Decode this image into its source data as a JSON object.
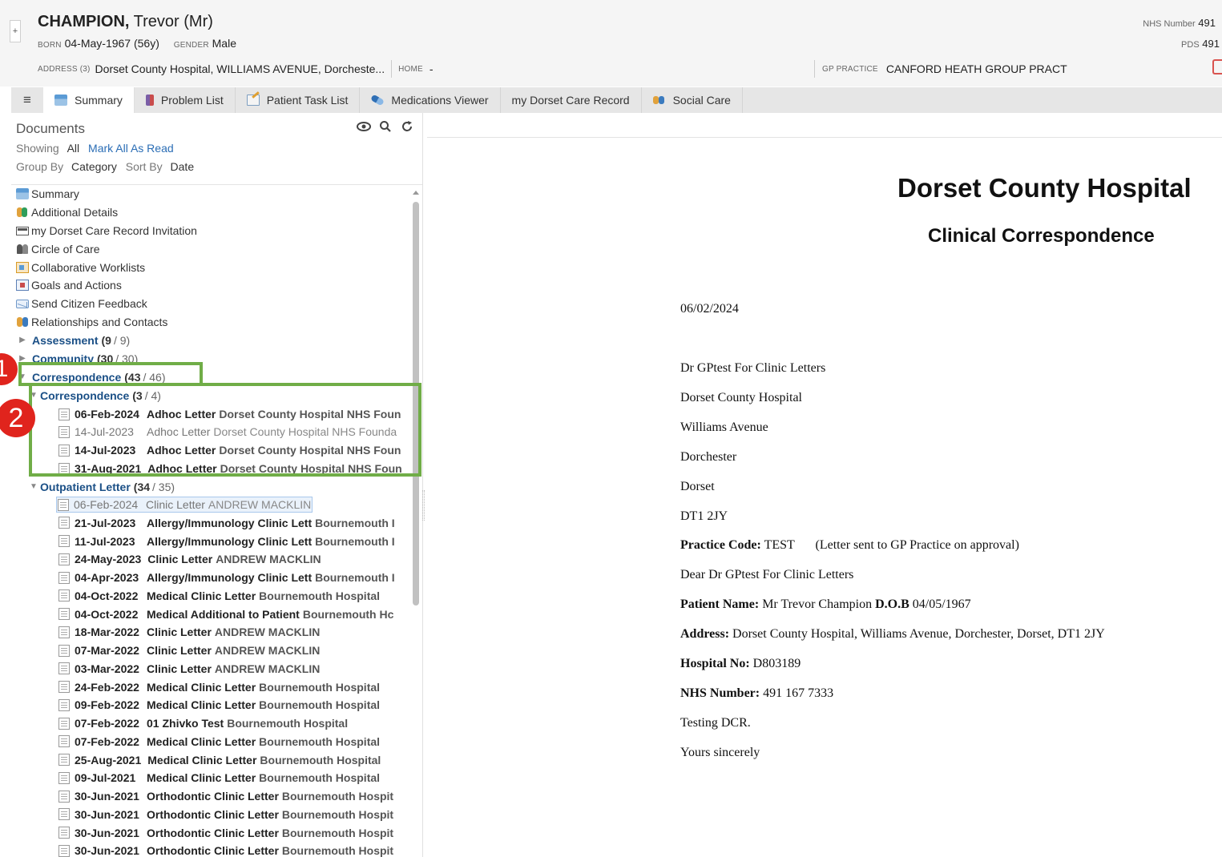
{
  "patient": {
    "surname": "CHAMPION,",
    "forename_title": "Trevor (Mr)",
    "born_label": "BORN",
    "born_value": "04-May-1967 (56y)",
    "gender_label": "GENDER",
    "gender_value": "Male",
    "address_label": "ADDRESS (3)",
    "address_value": "Dorset County Hospital, WILLIAMS AVENUE, Dorcheste...",
    "home_label": "HOME",
    "home_value": "-",
    "gp_label": "GP PRACTICE",
    "gp_value": "CANFORD HEATH GROUP PRACT",
    "nhs_label": "NHS Number",
    "nhs_value": "491",
    "pds_label": "PDS",
    "pds_value": "491",
    "expand_glyph": "+"
  },
  "tabs": [
    {
      "label": "Summary",
      "icon": "summary-icon",
      "active": true
    },
    {
      "label": "Problem List",
      "icon": "problem-list-icon"
    },
    {
      "label": "Patient Task List",
      "icon": "task-list-icon"
    },
    {
      "label": "Medications Viewer",
      "icon": "pill-icon"
    },
    {
      "label": "my Dorset Care Record",
      "icon": ""
    },
    {
      "label": "Social Care",
      "icon": "social-care-icon"
    }
  ],
  "menu_glyph": "≡",
  "documents": {
    "title": "Documents",
    "showing_label": "Showing",
    "showing_value": "All",
    "mark_all_read": "Mark All As Read",
    "group_by_label": "Group By",
    "group_by_value": "Category",
    "sort_by_label": "Sort By",
    "sort_by_value": "Date",
    "nav_items": [
      {
        "label": "Summary",
        "icon": "summary-icon"
      },
      {
        "label": "Additional Details",
        "icon": "people-icon"
      },
      {
        "label": "my Dorset Care Record Invitation",
        "icon": "invitation-icon"
      },
      {
        "label": "Circle of Care",
        "icon": "circle-of-care-icon"
      },
      {
        "label": "Collaborative Worklists",
        "icon": "worklist-icon"
      },
      {
        "label": "Goals and Actions",
        "icon": "goals-icon"
      },
      {
        "label": "Send Citizen Feedback",
        "icon": "envelope-icon"
      },
      {
        "label": "Relationships and Contacts",
        "icon": "relationships-icon"
      }
    ],
    "categories": [
      {
        "label": "Assessment",
        "bold_count": "(9",
        "total": "/ 9)"
      },
      {
        "label": "Community",
        "bold_count": "(30",
        "total": "/ 30)"
      },
      {
        "label": "Correspondence",
        "bold_count": "(43",
        "total": "/ 46)"
      }
    ],
    "subcategories": [
      {
        "label": "Correspondence",
        "bold_count": "(3",
        "total": "/ 4)"
      },
      {
        "label": "Outpatient Letter",
        "bold_count": "(34",
        "total": "/ 35)"
      }
    ],
    "correspondence_docs": [
      {
        "date": "06-Feb-2024",
        "type": "Adhoc Letter",
        "source": "Dorset County Hospital NHS Foun",
        "read": false
      },
      {
        "date": "14-Jul-2023",
        "type": "Adhoc Letter",
        "source": "Dorset County Hospital NHS Founda",
        "read": true
      },
      {
        "date": "14-Jul-2023",
        "type": "Adhoc Letter",
        "source": "Dorset County Hospital NHS Foun",
        "read": false
      },
      {
        "date": "31-Aug-2021",
        "type": "Adhoc Letter",
        "source": "Dorset County Hospital NHS Foun",
        "read": false
      }
    ],
    "outpatient_docs": [
      {
        "date": "06-Feb-2024",
        "type": "Clinic Letter",
        "source": "ANDREW MACKLIN",
        "read": true,
        "selected": true
      },
      {
        "date": "21-Jul-2023",
        "type": "Allergy/Immunology Clinic Lett",
        "source": "Bournemouth I",
        "read": false
      },
      {
        "date": "11-Jul-2023",
        "type": "Allergy/Immunology Clinic Lett",
        "source": "Bournemouth I",
        "read": false
      },
      {
        "date": "24-May-2023",
        "type": "Clinic Letter",
        "source": "ANDREW MACKLIN",
        "read": false
      },
      {
        "date": "04-Apr-2023",
        "type": "Allergy/Immunology Clinic Lett",
        "source": "Bournemouth I",
        "read": false
      },
      {
        "date": "04-Oct-2022",
        "type": "Medical Clinic Letter",
        "source": "Bournemouth Hospital",
        "read": false
      },
      {
        "date": "04-Oct-2022",
        "type": "Medical Additional to Patient",
        "source": "Bournemouth Hc",
        "read": false
      },
      {
        "date": "18-Mar-2022",
        "type": "Clinic Letter",
        "source": "ANDREW MACKLIN",
        "read": false
      },
      {
        "date": "07-Mar-2022",
        "type": "Clinic Letter",
        "source": "ANDREW MACKLIN",
        "read": false
      },
      {
        "date": "03-Mar-2022",
        "type": "Clinic Letter",
        "source": "ANDREW MACKLIN",
        "read": false
      },
      {
        "date": "24-Feb-2022",
        "type": "Medical Clinic Letter",
        "source": "Bournemouth Hospital",
        "read": false
      },
      {
        "date": "09-Feb-2022",
        "type": "Medical Clinic Letter",
        "source": "Bournemouth Hospital",
        "read": false
      },
      {
        "date": "07-Feb-2022",
        "type": "01 Zhivko Test",
        "source": "Bournemouth Hospital",
        "read": false
      },
      {
        "date": "07-Feb-2022",
        "type": "Medical Clinic Letter",
        "source": "Bournemouth Hospital",
        "read": false
      },
      {
        "date": "25-Aug-2021",
        "type": "Medical Clinic Letter",
        "source": "Bournemouth Hospital",
        "read": false
      },
      {
        "date": "09-Jul-2021",
        "type": "Medical Clinic Letter",
        "source": "Bournemouth Hospital",
        "read": false
      },
      {
        "date": "30-Jun-2021",
        "type": "Orthodontic Clinic Letter",
        "source": "Bournemouth Hospit",
        "read": false
      },
      {
        "date": "30-Jun-2021",
        "type": "Orthodontic Clinic Letter",
        "source": "Bournemouth Hospit",
        "read": false
      },
      {
        "date": "30-Jun-2021",
        "type": "Orthodontic Clinic Letter",
        "source": "Bournemouth Hospit",
        "read": false
      },
      {
        "date": "30-Jun-2021",
        "type": "Orthodontic Clinic Letter",
        "source": "Bournemouth Hospit",
        "read": false
      }
    ]
  },
  "markers": [
    "1",
    "2"
  ],
  "annotation_color": "#70ad47",
  "marker_color": "#e0241d",
  "letter": {
    "organisation": "Dorset County Hospital",
    "doc_type": "Clinical Correspondence",
    "date": "06/02/2024",
    "recipient_lines": [
      "Dr GPtest For Clinic Letters",
      "Dorset County Hospital",
      "Williams Avenue",
      "Dorchester",
      "Dorset",
      "DT1 2JY"
    ],
    "practice_code_label": "Practice Code:",
    "practice_code_value": "TEST",
    "practice_note": "(Letter sent to GP Practice on approval)",
    "salutation": "Dear Dr GPtest For Clinic Letters",
    "patient_name_label": "Patient Name:",
    "patient_name_value": "Mr Trevor Champion",
    "dob_label": "D.O.B",
    "dob_value": "04/05/1967",
    "address_label": "Address:",
    "address_value": "Dorset County Hospital, Williams Avenue, Dorchester, Dorset, DT1 2JY",
    "hospital_no_label": "Hospital No:",
    "hospital_no_value": "D803189",
    "nhs_label": "NHS Number:",
    "nhs_value": "491 167 7333",
    "body": "Testing DCR.",
    "closing": "Yours sincerely"
  }
}
